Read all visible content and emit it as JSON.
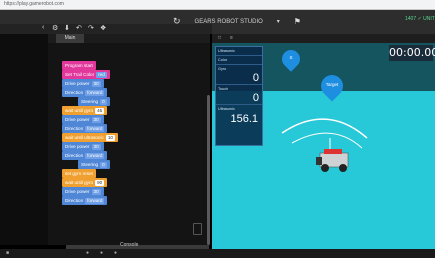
{
  "browser": {
    "url": "https://play.gamerobot.com"
  },
  "topbar": {
    "center_label": "GEARS ROBOT STUDIO",
    "status": "1407 ✓ UNIT"
  },
  "workspace_tab": {
    "label": "Main"
  },
  "blocks": [
    {
      "text": "Program start",
      "color": "#e2389c"
    },
    {
      "text": "Set Trail Color",
      "color": "#e2389c",
      "value": "red"
    },
    {
      "text": "Drive  power",
      "color": "#4f86d6",
      "value": "30"
    },
    {
      "text": "Direction",
      "color": "#4f86d6",
      "value": "forward"
    },
    {
      "text": "Steering",
      "color": "#4f86d6",
      "value": "0"
    },
    {
      "text": "wait until  gyro",
      "color": "#f0a030",
      "value": "45"
    },
    {
      "text": "Drive  power",
      "color": "#4f86d6",
      "value": "30"
    },
    {
      "text": "Direction",
      "color": "#4f86d6",
      "value": "forward"
    },
    {
      "text": "wait until  ultrasonic",
      "color": "#f0a030",
      "value": "10"
    },
    {
      "text": "Drive  power",
      "color": "#4f86d6",
      "value": "30"
    },
    {
      "text": "Direction",
      "color": "#4f86d6",
      "value": "forward"
    },
    {
      "text": "Steering",
      "color": "#4f86d6",
      "value": "0"
    },
    {
      "text": "set  gyro  reset",
      "color": "#f0a030",
      "value": ""
    },
    {
      "text": "wait until  gyro",
      "color": "#f0a030",
      "value": "90"
    },
    {
      "text": "Drive  power",
      "color": "#4f86d6",
      "value": "30"
    },
    {
      "text": "Direction",
      "color": "#4f86d6",
      "value": "forward"
    }
  ],
  "console": {
    "label": "Console"
  },
  "simulator": {
    "timer": "00:00.00",
    "sensors": [
      {
        "label": "Ultrasonic",
        "value": ""
      },
      {
        "label": "Color",
        "value": ""
      },
      {
        "label": "Gyro",
        "value": "0"
      },
      {
        "label": "Touch",
        "value": "0"
      },
      {
        "label": "Ultrasonic",
        "value": "156.1"
      }
    ],
    "markers": [
      {
        "label": "S"
      },
      {
        "label": "Target"
      }
    ]
  }
}
